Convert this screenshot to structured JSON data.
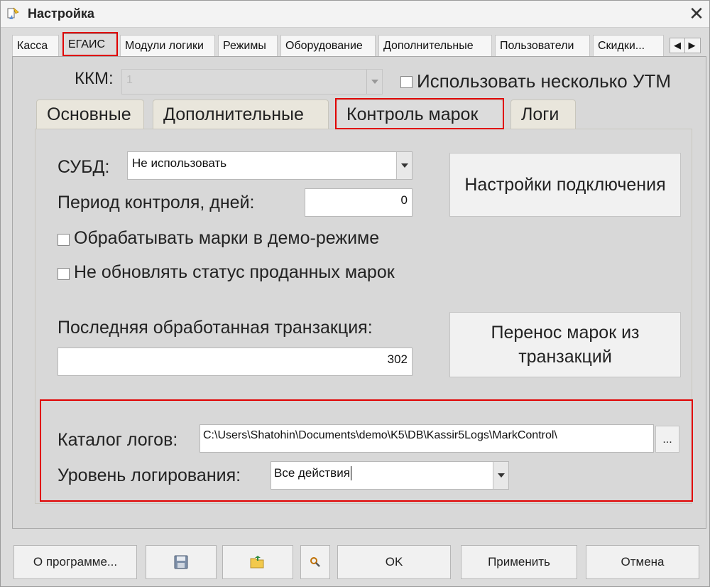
{
  "window": {
    "title": "Настройка",
    "close_symbol": "✕"
  },
  "top_tabs": [
    {
      "label": "Касса"
    },
    {
      "label": "ЕГАИС"
    },
    {
      "label": "Модули логики"
    },
    {
      "label": "Режимы"
    },
    {
      "label": "Оборудование"
    },
    {
      "label": "Дополнительные"
    },
    {
      "label": "Пользователи"
    },
    {
      "label": "Скидки..."
    }
  ],
  "top_tabs_active": "ЕГАИС",
  "scroll": {
    "left": "◀",
    "right": "▶"
  },
  "kkm": {
    "label": "ККМ:",
    "value": "1"
  },
  "multi_utm": {
    "label": "Использовать несколько УТМ",
    "checked": false
  },
  "inner_tabs": [
    {
      "label": "Основные"
    },
    {
      "label": "Дополнительные"
    },
    {
      "label": "Контроль марок"
    },
    {
      "label": "Логи"
    }
  ],
  "inner_tabs_active": "Контроль марок",
  "subd": {
    "label": "СУБД:",
    "value": "Не использовать"
  },
  "period": {
    "label": "Период контроля, дней:",
    "value": "0"
  },
  "connection_button": "Настройки подключения",
  "demo_checkbox": {
    "label": "Обрабатывать марки в демо-режиме",
    "checked": false
  },
  "status_checkbox": {
    "label": "Не обновлять статус проданных марок",
    "checked": false
  },
  "last_transaction": {
    "label": "Последняя обработанная транзакция:",
    "value": "302"
  },
  "transfer_button": {
    "line1": "Перенос марок из",
    "line2": "транзакций"
  },
  "log_dir": {
    "label": "Каталог логов:",
    "value": "C:\\Users\\Shatohin\\Documents\\demo\\K5\\DB\\Kassir5Logs\\MarkControl\\",
    "browse_label": "..."
  },
  "log_level": {
    "label": "Уровень логирования:",
    "value": "Все действия"
  },
  "bottom_buttons": {
    "about": "О программе...",
    "ok": "OK",
    "apply": "Применить",
    "cancel": "Отмена"
  },
  "icons": {
    "title": "settings-app-icon",
    "save": "floppy-disk-icon",
    "open": "folder-open-icon",
    "search": "magnifier-icon"
  },
  "colors": {
    "highlight": "#e00000",
    "window_bg": "#dcdcdc",
    "inner_tab_bg": "#e9e6dc"
  }
}
